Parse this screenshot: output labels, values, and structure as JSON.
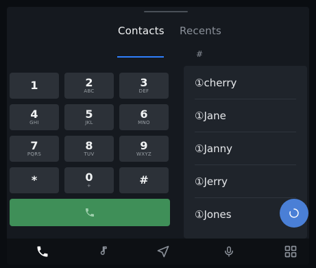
{
  "tabs": [
    {
      "label": "Contacts",
      "active": true
    },
    {
      "label": "Recents",
      "active": false
    }
  ],
  "index_letter": "#",
  "keypad": {
    "keys": [
      {
        "digit": "1",
        "letters": ""
      },
      {
        "digit": "2",
        "letters": "ABC"
      },
      {
        "digit": "3",
        "letters": "DEF"
      },
      {
        "digit": "4",
        "letters": "GHI"
      },
      {
        "digit": "5",
        "letters": "JKL"
      },
      {
        "digit": "6",
        "letters": "MNO"
      },
      {
        "digit": "7",
        "letters": "PQRS"
      },
      {
        "digit": "8",
        "letters": "TUV"
      },
      {
        "digit": "9",
        "letters": "WXYZ"
      },
      {
        "digit": "*",
        "letters": ""
      },
      {
        "digit": "0",
        "letters": "+"
      },
      {
        "digit": "#",
        "letters": ""
      }
    ],
    "call_icon": "phone-icon"
  },
  "contacts": [
    {
      "name": "①cherry"
    },
    {
      "name": "①Jane"
    },
    {
      "name": "①Janny"
    },
    {
      "name": "①Jerry"
    },
    {
      "name": "①Jones"
    }
  ],
  "refresh_icon": "refresh-icon",
  "bottom_nav": [
    {
      "icon": "phone-icon",
      "active": true
    },
    {
      "icon": "music-note-icon",
      "active": false
    },
    {
      "icon": "navigation-icon",
      "active": false
    },
    {
      "icon": "microphone-icon",
      "active": false
    },
    {
      "icon": "apps-grid-icon",
      "active": false
    }
  ],
  "colors": {
    "accent": "#2f80ff",
    "call_button": "#3f8f58",
    "fab": "#4a7fd6",
    "key_background": "#2c3138"
  }
}
